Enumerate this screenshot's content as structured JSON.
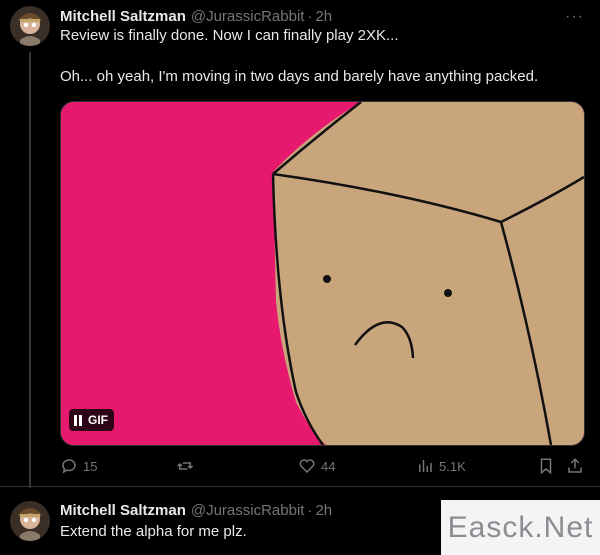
{
  "tweet1": {
    "name": "Mitchell Saltzman",
    "handle": "@JurassicRabbit",
    "separator": "·",
    "time": "2h",
    "more_icon": "more-horizontal-icon",
    "line1": "Review is finally done. Now I can finally play 2XK...",
    "line2": "Oh... oh yeah, I'm moving in two days and barely have anything packed.",
    "media": {
      "badge_label": "GIF",
      "colors": {
        "background": "#e6196f",
        "box": "#c9a57c"
      }
    },
    "actions": {
      "replies": "15",
      "retweets": "",
      "likes": "44",
      "views": "5.1K"
    }
  },
  "tweet2": {
    "name": "Mitchell Saltzman",
    "handle": "@JurassicRabbit",
    "separator": "·",
    "time": "2h",
    "text": "Extend the alpha for me plz."
  },
  "watermark": {
    "text": "Easck.Net"
  }
}
